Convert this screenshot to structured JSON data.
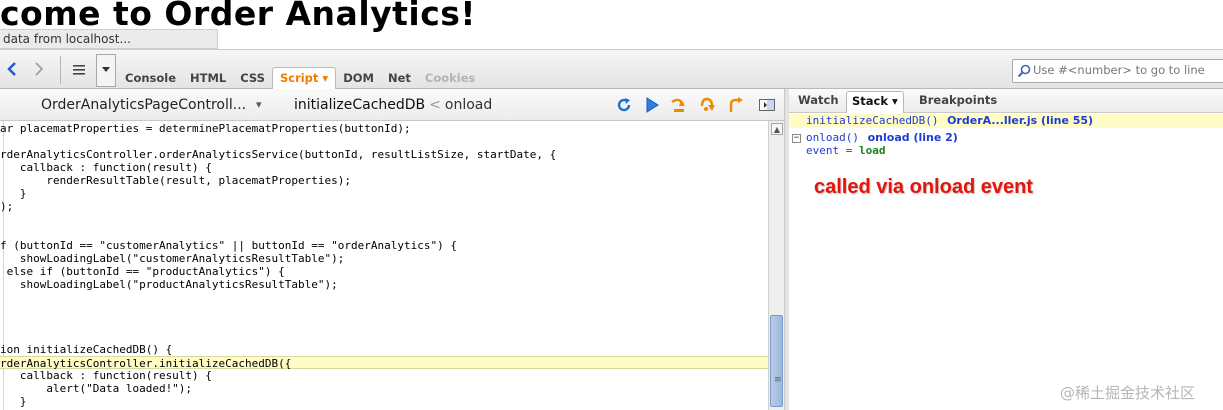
{
  "page": {
    "heading": "come to Order Analytics!",
    "status_text": "data from localhost..."
  },
  "toolbar": {
    "back_icon": "chevron-left-icon",
    "forward_icon": "chevron-right-icon",
    "menu_icon": "list-icon",
    "tabs": [
      {
        "label": "Console",
        "state": "normal"
      },
      {
        "label": "HTML",
        "state": "normal"
      },
      {
        "label": "CSS",
        "state": "normal"
      },
      {
        "label": "Script ▾",
        "state": "active"
      },
      {
        "label": "DOM",
        "state": "normal"
      },
      {
        "label": "Net",
        "state": "normal"
      },
      {
        "label": "Cookies",
        "state": "disabled"
      }
    ],
    "search_placeholder": "Use #<number> to go to line"
  },
  "script_header": {
    "file": "OrderAnalyticsPageControll...",
    "crumb_current": "initializeCachedDB",
    "crumb_sep": "<",
    "crumb_prev": "onload"
  },
  "code_lines": [
    "ar placematProperties = determinePlacematProperties(buttonId);",
    "",
    "rderAnalyticsController.orderAnalyticsService(buttonId, resultListSize, startDate, {",
    "   callback : function(result) {",
    "       renderResultTable(result, placematProperties);",
    "   }",
    ");",
    "",
    "",
    "f (buttonId == \"customerAnalytics\" || buttonId == \"orderAnalytics\") {",
    "   showLoadingLabel(\"customerAnalyticsResultTable\");",
    " else if (buttonId == \"productAnalytics\") {",
    "   showLoadingLabel(\"productAnalyticsResultTable\");",
    "",
    "",
    "",
    "",
    "ion initializeCachedDB() {",
    "rderAnalyticsController.initializeCachedDB({",
    "   callback : function(result) {",
    "       alert(\"Data loaded!\");",
    "   }",
    ");"
  ],
  "current_line_index": 18,
  "side_panel": {
    "tabs": [
      "Watch",
      "Stack ▾",
      "Breakpoints"
    ],
    "active_tab": 1,
    "frames": [
      {
        "fn": "initializeCachedDB()",
        "src": "OrderA...ller.js (line 55)"
      },
      {
        "fn": "onload()",
        "src": "onload (line 2)"
      }
    ],
    "variable": {
      "name": "event",
      "eq": "=",
      "value": "load"
    },
    "twisty": "−"
  },
  "annotation": "called via onload event",
  "watermark": "@稀土掘金技术社区",
  "colors": {
    "active_tab": "#f57b00",
    "annotation": "#e8140c",
    "current_line_bg": "#fffcc6",
    "link_blue": "#1d3bd8",
    "value_green": "#18801c"
  }
}
